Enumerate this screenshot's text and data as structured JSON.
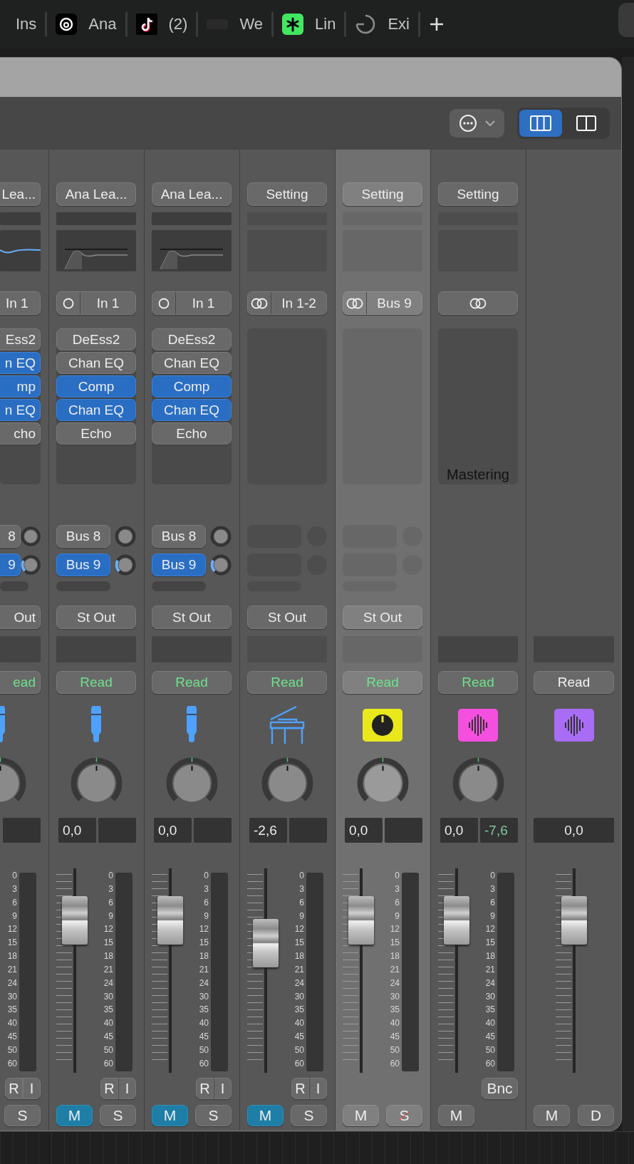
{
  "tab_bar": {
    "tabs": [
      {
        "label": "Ins"
      },
      {
        "kind": "swirl",
        "label": "Ana"
      },
      {
        "kind": "note",
        "label": "(2)"
      },
      {
        "kind": "wordmark",
        "label": "We"
      },
      {
        "kind": "asterisk",
        "label": "Lin"
      },
      {
        "kind": "ring",
        "label": "Exi"
      },
      {
        "kind": "plus"
      }
    ]
  },
  "window": {
    "toolbar": {
      "view_modes": [
        {
          "kind": "columns3",
          "selected": true
        },
        {
          "kind": "columns2",
          "selected": false
        }
      ]
    },
    "strips": [
      {
        "kind": "audio",
        "partial": true,
        "selected": false,
        "setting": "Lea...",
        "eq": {
          "kind": "active"
        },
        "input": {
          "label": "In 1"
        },
        "inserts": [
          {
            "label": "Ess2",
            "on": false
          },
          {
            "label": "n EQ",
            "on": true
          },
          {
            "label": "mp",
            "on": true
          },
          {
            "label": "n EQ",
            "on": true
          },
          {
            "label": "cho",
            "on": false
          }
        ],
        "sends": [
          {
            "label": "8",
            "on": false
          },
          {
            "label": "9",
            "on": true
          }
        ],
        "output": "Out",
        "automation": {
          "label": "ead",
          "on": true
        },
        "icon": {
          "kind": "mic",
          "color": "#4ea1ff"
        },
        "scale": [
          "0",
          "3",
          "6",
          "9",
          "12",
          "15",
          "18",
          "21",
          "24",
          "30",
          "35",
          "40",
          "45",
          "50",
          "60"
        ],
        "record_buttons": [
          "R",
          "I"
        ],
        "buttons": [
          {
            "kind": "solo",
            "label": "S",
            "on": false,
            "safe": false
          }
        ]
      },
      {
        "kind": "audio",
        "selected": false,
        "setting": "Ana Lea...",
        "eq": {
          "kind": "bypassed"
        },
        "input": {
          "kind": "mono",
          "label": "In 1"
        },
        "inserts": [
          {
            "label": "DeEss2",
            "on": false
          },
          {
            "label": "Chan EQ",
            "on": false
          },
          {
            "label": "Comp",
            "on": true
          },
          {
            "label": "Chan EQ",
            "on": true
          },
          {
            "label": "Echo",
            "on": false
          }
        ],
        "sends": [
          {
            "label": "Bus 8",
            "on": false
          },
          {
            "label": "Bus 9",
            "on": true
          }
        ],
        "output": "St Out",
        "automation": {
          "label": "Read",
          "on": true
        },
        "icon": {
          "kind": "mic",
          "color": "#4ea1ff"
        },
        "volume": "0,0",
        "level": 0.745,
        "scale": [
          "0",
          "3",
          "6",
          "9",
          "12",
          "15",
          "18",
          "21",
          "24",
          "30",
          "35",
          "40",
          "45",
          "50",
          "60"
        ],
        "record_buttons": [
          "R",
          "I"
        ],
        "buttons": [
          {
            "kind": "mute",
            "label": "M",
            "on": true
          },
          {
            "kind": "solo",
            "label": "S",
            "on": false,
            "safe": false
          }
        ]
      },
      {
        "kind": "audio",
        "selected": false,
        "setting": "Ana Lea...",
        "eq": {
          "kind": "bypassed"
        },
        "input": {
          "kind": "mono",
          "label": "In 1"
        },
        "inserts": [
          {
            "label": "DeEss2",
            "on": false
          },
          {
            "label": "Chan EQ",
            "on": false
          },
          {
            "label": "Comp",
            "on": true
          },
          {
            "label": "Chan EQ",
            "on": true
          },
          {
            "label": "Echo",
            "on": false
          }
        ],
        "sends": [
          {
            "label": "Bus 8",
            "on": false
          },
          {
            "label": "Bus 9",
            "on": true
          }
        ],
        "output": "St Out",
        "automation": {
          "label": "Read",
          "on": true
        },
        "icon": {
          "kind": "mic",
          "color": "#4ea1ff"
        },
        "volume": "0,0",
        "level": 0.745,
        "scale": [
          "0",
          "3",
          "6",
          "9",
          "12",
          "15",
          "18",
          "21",
          "24",
          "30",
          "35",
          "40",
          "45",
          "50",
          "60"
        ],
        "record_buttons": [
          "R",
          "I"
        ],
        "buttons": [
          {
            "kind": "mute",
            "label": "M",
            "on": true
          },
          {
            "kind": "solo",
            "label": "S",
            "on": false,
            "safe": false
          }
        ]
      },
      {
        "kind": "instrument",
        "selected": false,
        "setting": "Setting",
        "input": {
          "kind": "stereo",
          "label": "In 1-2"
        },
        "output": "St Out",
        "automation": {
          "label": "Read",
          "on": true
        },
        "icon": {
          "kind": "piano",
          "color": "#4ea1ff"
        },
        "volume": "-2,6",
        "level": 0.635,
        "scale": [
          "0",
          "3",
          "6",
          "9",
          "12",
          "15",
          "18",
          "21",
          "24",
          "30",
          "35",
          "40",
          "45",
          "50",
          "60"
        ],
        "record_buttons": [
          "R",
          "I"
        ],
        "buttons": [
          {
            "kind": "mute",
            "label": "M",
            "on": true
          },
          {
            "kind": "solo",
            "label": "S",
            "on": false,
            "safe": false
          }
        ]
      },
      {
        "kind": "aux",
        "selected": true,
        "setting": "Setting",
        "input": {
          "kind": "stereo",
          "label": "Bus 9"
        },
        "output": "St Out",
        "automation": {
          "label": "Read",
          "on": true
        },
        "icon": {
          "kind": "dial",
          "color": "#e8e81c"
        },
        "volume": "0,0",
        "level": 0.745,
        "scale": [
          "0",
          "3",
          "6",
          "9",
          "12",
          "15",
          "18",
          "21",
          "24",
          "30",
          "35",
          "40",
          "45",
          "50",
          "60"
        ],
        "buttons": [
          {
            "kind": "mute",
            "label": "M",
            "on": false
          },
          {
            "kind": "solo",
            "label": "S",
            "on": false,
            "safe": true
          }
        ]
      },
      {
        "kind": "output",
        "selected": false,
        "setting": "Setting",
        "input": {
          "kind": "stereo"
        },
        "insert_label": "Mastering",
        "automation": {
          "label": "Read",
          "on": true
        },
        "icon": {
          "kind": "waveform",
          "color": "#f54fe0"
        },
        "volume": "0,0",
        "peak": "-7,6",
        "level": 0.745,
        "scale": [
          "0",
          "3",
          "6",
          "9",
          "12",
          "15",
          "18",
          "21",
          "24",
          "30",
          "35",
          "40",
          "45",
          "50",
          "60"
        ],
        "bounce": "Bnc",
        "buttons": [
          {
            "kind": "mute",
            "label": "M",
            "on": false
          }
        ]
      },
      {
        "kind": "master",
        "selected": false,
        "automation": {
          "label": "Read",
          "on": false
        },
        "icon": {
          "kind": "waveform",
          "color": "#a86cf5"
        },
        "volume": "0,0",
        "level": 0.745,
        "buttons": [
          {
            "kind": "mute",
            "label": "M",
            "on": false
          },
          {
            "kind": "dim",
            "label": "D",
            "on": false
          }
        ]
      }
    ]
  }
}
